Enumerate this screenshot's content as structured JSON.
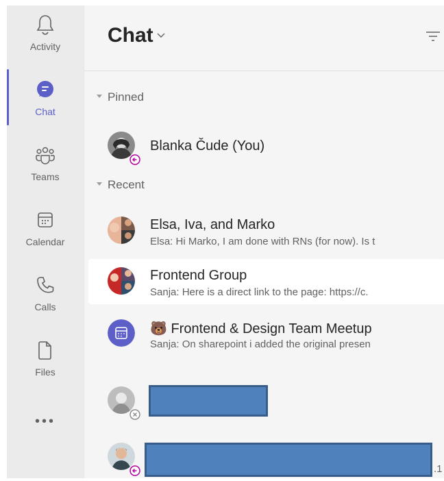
{
  "appbar": {
    "items": [
      {
        "label": "Activity",
        "icon": "bell-icon"
      },
      {
        "label": "Chat",
        "icon": "chat-bubble-icon"
      },
      {
        "label": "Teams",
        "icon": "people-group-icon"
      },
      {
        "label": "Calendar",
        "icon": "calendar-icon"
      },
      {
        "label": "Calls",
        "icon": "phone-icon"
      },
      {
        "label": "Files",
        "icon": "file-icon"
      }
    ],
    "more": "•••",
    "active": "Chat",
    "accent": "#5b5fc7"
  },
  "header": {
    "title": "Chat"
  },
  "sections": {
    "pinned": "Pinned",
    "recent": "Recent"
  },
  "chats": {
    "pinned": [
      {
        "name": "Blanka Čude (You)",
        "status": "out-of-office"
      }
    ],
    "recent": [
      {
        "name": "Elsa, Iva, and Marko",
        "preview": "Elsa: Hi Marko, I am done with RNs (for now). Is t"
      },
      {
        "name": "Frontend Group",
        "preview": "Sanja: Here is a direct link to the page: https://c."
      },
      {
        "name": "Frontend & Design Team Meetup",
        "emoji": "🐻",
        "preview": "Sanja: On sharepoint i added the original presen"
      },
      {
        "name": "",
        "status": "offline"
      },
      {
        "name": "",
        "suffix": ".1",
        "status": "out-of-office"
      }
    ]
  },
  "colors": {
    "redaction_fill": "#4f81bd",
    "redaction_border": "#385d8a",
    "out_of_office": "#b4009e"
  }
}
